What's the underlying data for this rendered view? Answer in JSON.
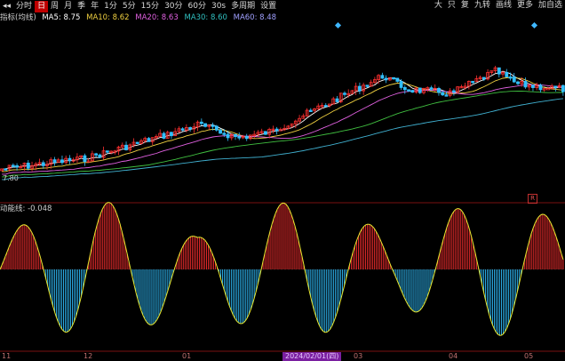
{
  "toolbar": {
    "left_items": [
      {
        "label": "◂◂",
        "active": false
      },
      {
        "label": "分时",
        "active": false
      },
      {
        "label": "日",
        "active": true
      },
      {
        "label": "周",
        "active": false
      },
      {
        "label": "月",
        "active": false
      },
      {
        "label": "季",
        "active": false
      },
      {
        "label": "年",
        "active": false
      },
      {
        "label": "1分",
        "active": false
      },
      {
        "label": "5分",
        "active": false
      },
      {
        "label": "15分",
        "active": false
      },
      {
        "label": "30分",
        "active": false
      },
      {
        "label": "60分",
        "active": false
      },
      {
        "label": "30s",
        "active": false
      },
      {
        "label": "多周期",
        "active": false
      },
      {
        "label": "设置",
        "active": false
      }
    ],
    "right_items": [
      "大",
      "只",
      "复",
      "九转",
      "画线",
      "更多",
      "加自选"
    ]
  },
  "indicator_header": {
    "name": "指标(均线)",
    "ma_labels": [
      {
        "text": "MA5: 8.75",
        "color": "#ffffff"
      },
      {
        "text": "MA10: 8.62",
        "color": "#f0d040"
      },
      {
        "text": "MA20: 8.63",
        "color": "#e060e0"
      },
      {
        "text": "MA30: 8.60",
        "color": "#30c0c0"
      },
      {
        "text": "MA60: 8.48",
        "color": "#a0a0ff"
      }
    ]
  },
  "macd_header": {
    "text": "动能线: -0.048"
  },
  "low_label": "7.80",
  "corner_mark": "R",
  "date_axis": [
    {
      "label": "11",
      "highlight": false
    },
    {
      "label": "12",
      "highlight": false
    },
    {
      "label": "01",
      "highlight": false
    },
    {
      "label": "2024/02/01(四)",
      "highlight": true
    },
    {
      "label": "03",
      "highlight": false
    },
    {
      "label": "04",
      "highlight": false
    },
    {
      "label": "05",
      "highlight": false
    }
  ],
  "colors": {
    "up": "#ff3030",
    "down": "#30c0ff",
    "ma5": "#ffffff",
    "ma10": "#f0d040",
    "ma20": "#e060e0",
    "ma30": "#40c040",
    "ma60": "#40b0d0"
  },
  "chart_data": {
    "type": "candlestick+histogram",
    "title": "",
    "price_trend": [
      7.8,
      8.0,
      8.2,
      8.5,
      8.3,
      8.6,
      8.9,
      8.7,
      8.8,
      9.2,
      8.9,
      8.8
    ]
  }
}
